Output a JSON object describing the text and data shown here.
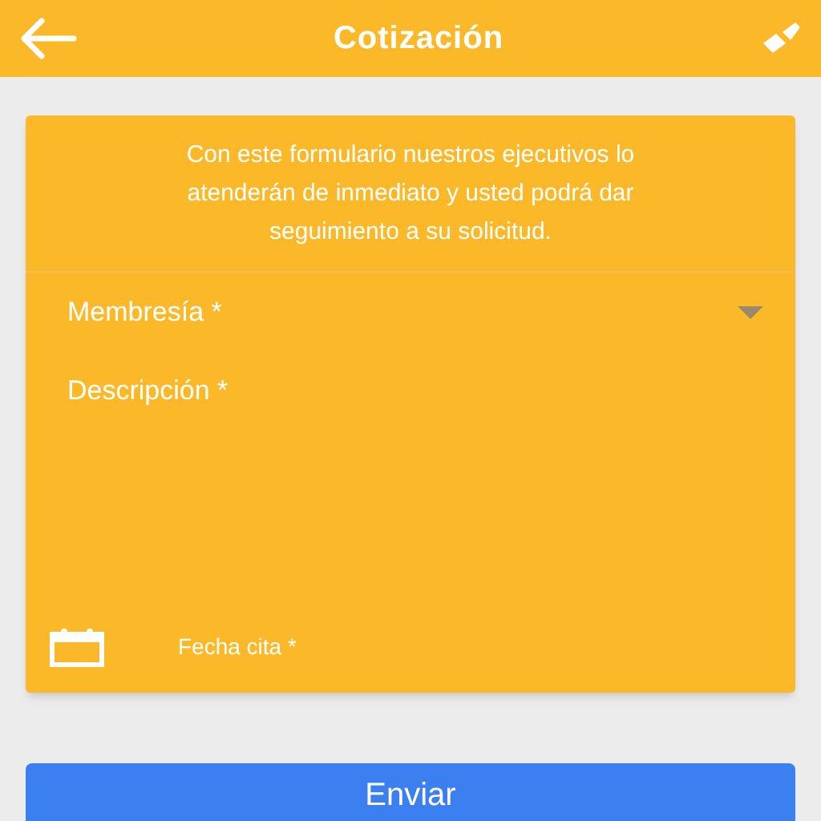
{
  "header": {
    "title": "Cotización"
  },
  "form": {
    "intro": "Con este formulario nuestros ejecutivos lo atenderán de inmediato y usted podrá dar seguimiento a su solicitud.",
    "fields": [
      {
        "kind": "select",
        "placeholder": "Membresía *"
      },
      {
        "kind": "textarea",
        "placeholder": "Descripción *"
      },
      {
        "kind": "date",
        "placeholder": "Fecha cita *"
      }
    ]
  },
  "submit": {
    "label": "Enviar"
  }
}
